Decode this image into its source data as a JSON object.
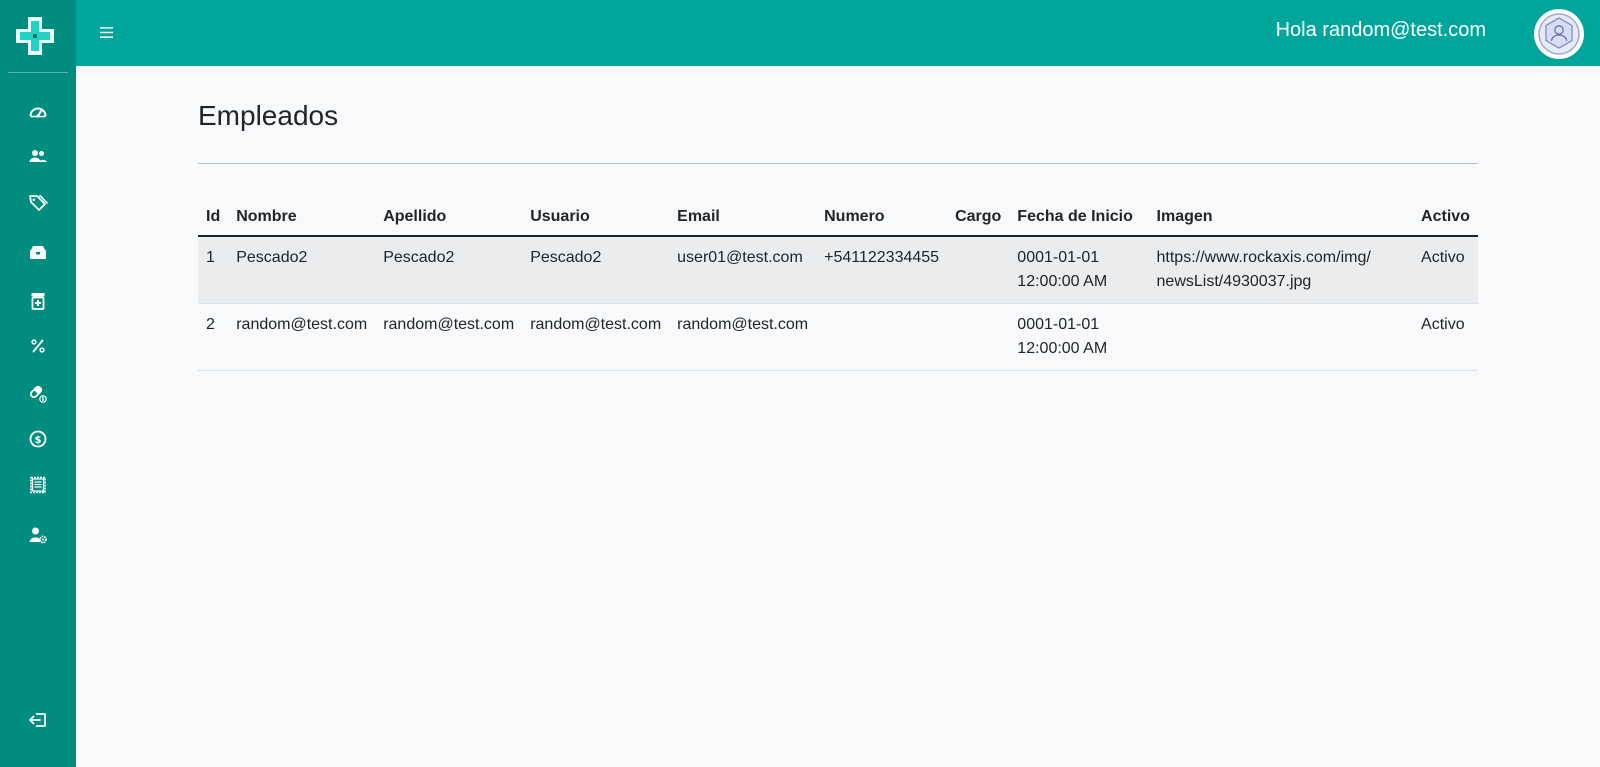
{
  "header": {
    "greeting": "Hola random@test.com"
  },
  "sidebar": {
    "items": [
      {
        "icon": "dashboard-icon"
      },
      {
        "icon": "users-icon"
      },
      {
        "icon": "tags-icon"
      },
      {
        "icon": "inventory-icon"
      },
      {
        "icon": "prescription-icon"
      },
      {
        "icon": "percent-icon"
      },
      {
        "icon": "pills-icon"
      },
      {
        "icon": "dollar-coin-icon"
      },
      {
        "icon": "receipt-icon"
      },
      {
        "icon": "user-settings-icon"
      }
    ],
    "logout_icon": "logout-icon"
  },
  "page": {
    "title": "Empleados"
  },
  "table": {
    "columns": [
      "Id",
      "Nombre",
      "Apellido",
      "Usuario",
      "Email",
      "Numero",
      "Cargo",
      "Fecha de Inicio",
      "Imagen",
      "Activo"
    ],
    "rows": [
      {
        "id": "1",
        "nombre": "Pescado2",
        "apellido": "Pescado2",
        "usuario": "Pescado2",
        "email": "user01@test.com",
        "numero": "+541122334455",
        "cargo": "",
        "fecha_line1": "0001-01-01",
        "fecha_line2": "12:00:00 AM",
        "imagen_line1": "https://www.rockaxis.com/img/",
        "imagen_line2": "newsList/4930037.jpg",
        "activo": "Activo"
      },
      {
        "id": "2",
        "nombre": "random@test.com",
        "apellido": "random@test.com",
        "usuario": "random@test.com",
        "email": "random@test.com",
        "numero": "",
        "cargo": "",
        "fecha_line1": "0001-01-01",
        "fecha_line2": "12:00:00 AM",
        "imagen_line1": "",
        "imagen_line2": "",
        "activo": "Activo"
      }
    ]
  },
  "colors": {
    "sidebar": "#008c7e",
    "topbar": "#00a69c",
    "background": "#f8f9fb",
    "striped_row": "#eaeced"
  }
}
